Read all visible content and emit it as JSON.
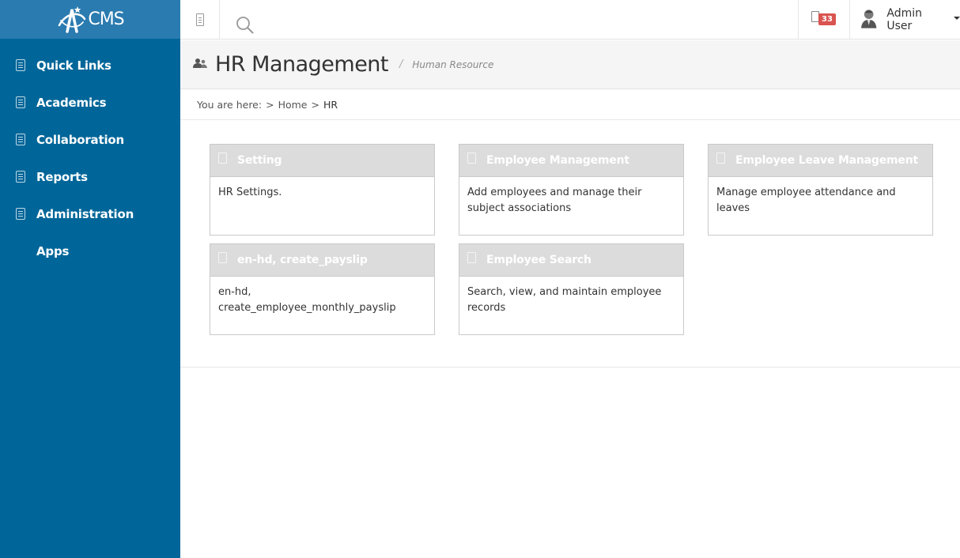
{
  "logo": {
    "text": "CMS"
  },
  "sidebar": {
    "items": [
      {
        "label": "Quick Links",
        "icon": "document-icon"
      },
      {
        "label": "Academics",
        "icon": "document-icon"
      },
      {
        "label": "Collaboration",
        "icon": "document-icon"
      },
      {
        "label": "Reports",
        "icon": "document-icon"
      },
      {
        "label": "Administration",
        "icon": "document-icon"
      },
      {
        "label": "Apps",
        "icon": ""
      }
    ]
  },
  "topbar": {
    "notification_count": "33",
    "user_name": "Admin User"
  },
  "page": {
    "title": "HR Management",
    "separator": "/",
    "subtitle": "Human Resource"
  },
  "breadcrumb": {
    "prefix": "You are here:",
    "sep": ">",
    "home": "Home",
    "current": "HR"
  },
  "cards": [
    {
      "title": "Setting",
      "description": "HR Settings."
    },
    {
      "title": "Employee Management",
      "description": "Add employees and manage their subject associations"
    },
    {
      "title": "Employee Leave Management",
      "description": "Manage employee attendance and leaves"
    },
    {
      "title": "en-hd, create_payslip",
      "description": "en-hd, create_employee_monthly_payslip"
    },
    {
      "title": "Employee Search",
      "description": "Search, view, and maintain employee records"
    }
  ],
  "colors": {
    "sidebar_bg": "#006699",
    "logo_bg": "#2a7bb0",
    "badge": "#d9534f",
    "card_header": "#dcdcdc"
  }
}
